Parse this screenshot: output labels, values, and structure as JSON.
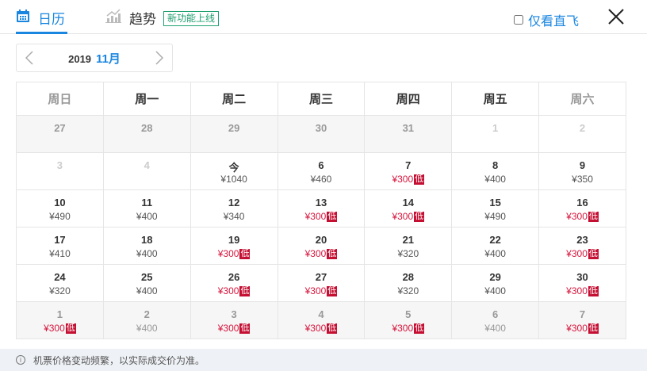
{
  "tabs": {
    "calendar": "日历",
    "trend": "趋势",
    "new_badge": "新功能上线"
  },
  "direct_only": {
    "label": "仅看直飞",
    "checked": false
  },
  "month_nav": {
    "year": "2019",
    "month": "11月"
  },
  "weekdays": [
    "周日",
    "周一",
    "周二",
    "周三",
    "周四",
    "周五",
    "周六"
  ],
  "weeks": [
    [
      {
        "d": "27",
        "p": "",
        "s": "prev"
      },
      {
        "d": "28",
        "p": "",
        "s": "prev"
      },
      {
        "d": "29",
        "p": "",
        "s": "prev"
      },
      {
        "d": "30",
        "p": "",
        "s": "prev"
      },
      {
        "d": "31",
        "p": "",
        "s": "prev"
      },
      {
        "d": "1",
        "p": "",
        "s": "dis"
      },
      {
        "d": "2",
        "p": "",
        "s": "dis"
      }
    ],
    [
      {
        "d": "3",
        "p": "",
        "s": "dis"
      },
      {
        "d": "4",
        "p": "",
        "s": "dis"
      },
      {
        "d": "今",
        "p": "¥1040"
      },
      {
        "d": "6",
        "p": "¥460"
      },
      {
        "d": "7",
        "p": "¥300",
        "low": true
      },
      {
        "d": "8",
        "p": "¥400"
      },
      {
        "d": "9",
        "p": "¥350"
      }
    ],
    [
      {
        "d": "10",
        "p": "¥490"
      },
      {
        "d": "11",
        "p": "¥400"
      },
      {
        "d": "12",
        "p": "¥340"
      },
      {
        "d": "13",
        "p": "¥300",
        "low": true
      },
      {
        "d": "14",
        "p": "¥300",
        "low": true
      },
      {
        "d": "15",
        "p": "¥490"
      },
      {
        "d": "16",
        "p": "¥300",
        "low": true
      }
    ],
    [
      {
        "d": "17",
        "p": "¥410"
      },
      {
        "d": "18",
        "p": "¥400"
      },
      {
        "d": "19",
        "p": "¥300",
        "low": true
      },
      {
        "d": "20",
        "p": "¥300",
        "low": true
      },
      {
        "d": "21",
        "p": "¥320"
      },
      {
        "d": "22",
        "p": "¥400"
      },
      {
        "d": "23",
        "p": "¥300",
        "low": true
      }
    ],
    [
      {
        "d": "24",
        "p": "¥320"
      },
      {
        "d": "25",
        "p": "¥400"
      },
      {
        "d": "26",
        "p": "¥300",
        "low": true
      },
      {
        "d": "27",
        "p": "¥300",
        "low": true
      },
      {
        "d": "28",
        "p": "¥320"
      },
      {
        "d": "29",
        "p": "¥400"
      },
      {
        "d": "30",
        "p": "¥300",
        "low": true
      }
    ],
    [
      {
        "d": "1",
        "p": "¥300",
        "low": true,
        "s": "next"
      },
      {
        "d": "2",
        "p": "¥400",
        "s": "next"
      },
      {
        "d": "3",
        "p": "¥300",
        "low": true,
        "s": "next"
      },
      {
        "d": "4",
        "p": "¥300",
        "low": true,
        "s": "next"
      },
      {
        "d": "5",
        "p": "¥300",
        "low": true,
        "s": "next"
      },
      {
        "d": "6",
        "p": "¥400",
        "s": "next"
      },
      {
        "d": "7",
        "p": "¥300",
        "low": true,
        "s": "next"
      }
    ]
  ],
  "low_label": "低",
  "footer": {
    "icon": "ⓘ",
    "text": "机票价格变动频繁，以实际成交价为准。"
  },
  "colors": {
    "accent": "#1a86e0",
    "low": "#c40f32",
    "badge": "#20a06f"
  }
}
